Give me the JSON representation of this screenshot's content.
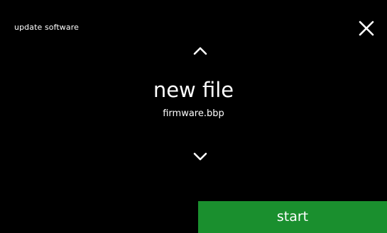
{
  "screen": {
    "title": "update software",
    "heading": "new file",
    "filename": "firmware.bbp"
  },
  "controls": {
    "close_icon": "close-x",
    "up_icon": "chevron-up",
    "down_icon": "chevron-down",
    "start_label": "start"
  },
  "colors": {
    "background": "#000000",
    "text": "#ffffff",
    "start_button": "#1a8f2e"
  }
}
